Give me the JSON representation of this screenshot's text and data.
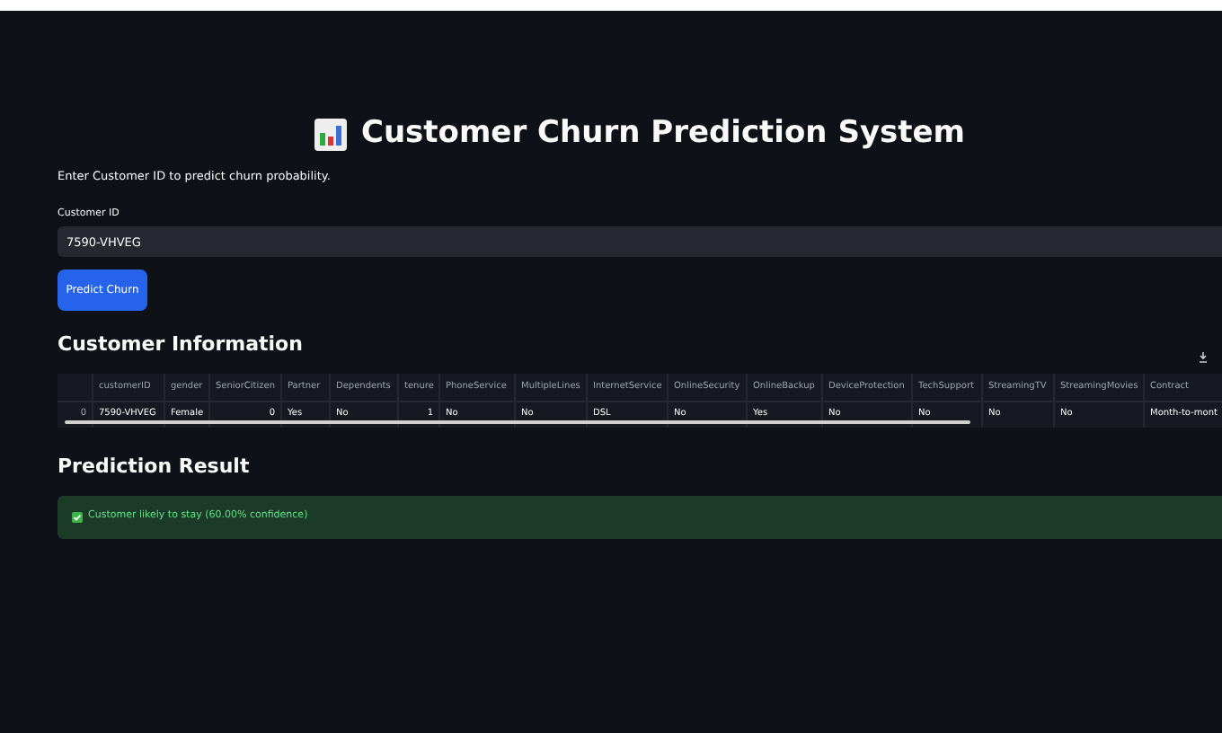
{
  "title": "Customer Churn Prediction System",
  "intro": "Enter Customer ID to predict churn probability.",
  "customer_id_field": {
    "label": "Customer ID",
    "value": "7590-VHVEG"
  },
  "predict_button": "Predict Churn",
  "customer_information": {
    "heading": "Customer Information",
    "table": {
      "columns": [
        "",
        "customerID",
        "gender",
        "SeniorCitizen",
        "Partner",
        "Dependents",
        "tenure",
        "PhoneService",
        "MultipleLines",
        "InternetService",
        "OnlineSecurity",
        "OnlineBackup",
        "DeviceProtection",
        "TechSupport",
        "StreamingTV",
        "StreamingMovies",
        "Contract"
      ],
      "rows": [
        [
          "0",
          "7590-VHVEG",
          "Female",
          "0",
          "Yes",
          "No",
          "1",
          "No",
          "No",
          "DSL",
          "No",
          "Yes",
          "No",
          "No",
          "No",
          "No",
          "Month-to-mont"
        ]
      ]
    }
  },
  "prediction_result": {
    "heading": "Prediction Result",
    "message": "Customer likely to stay (60.00% confidence)",
    "kind": "success"
  }
}
